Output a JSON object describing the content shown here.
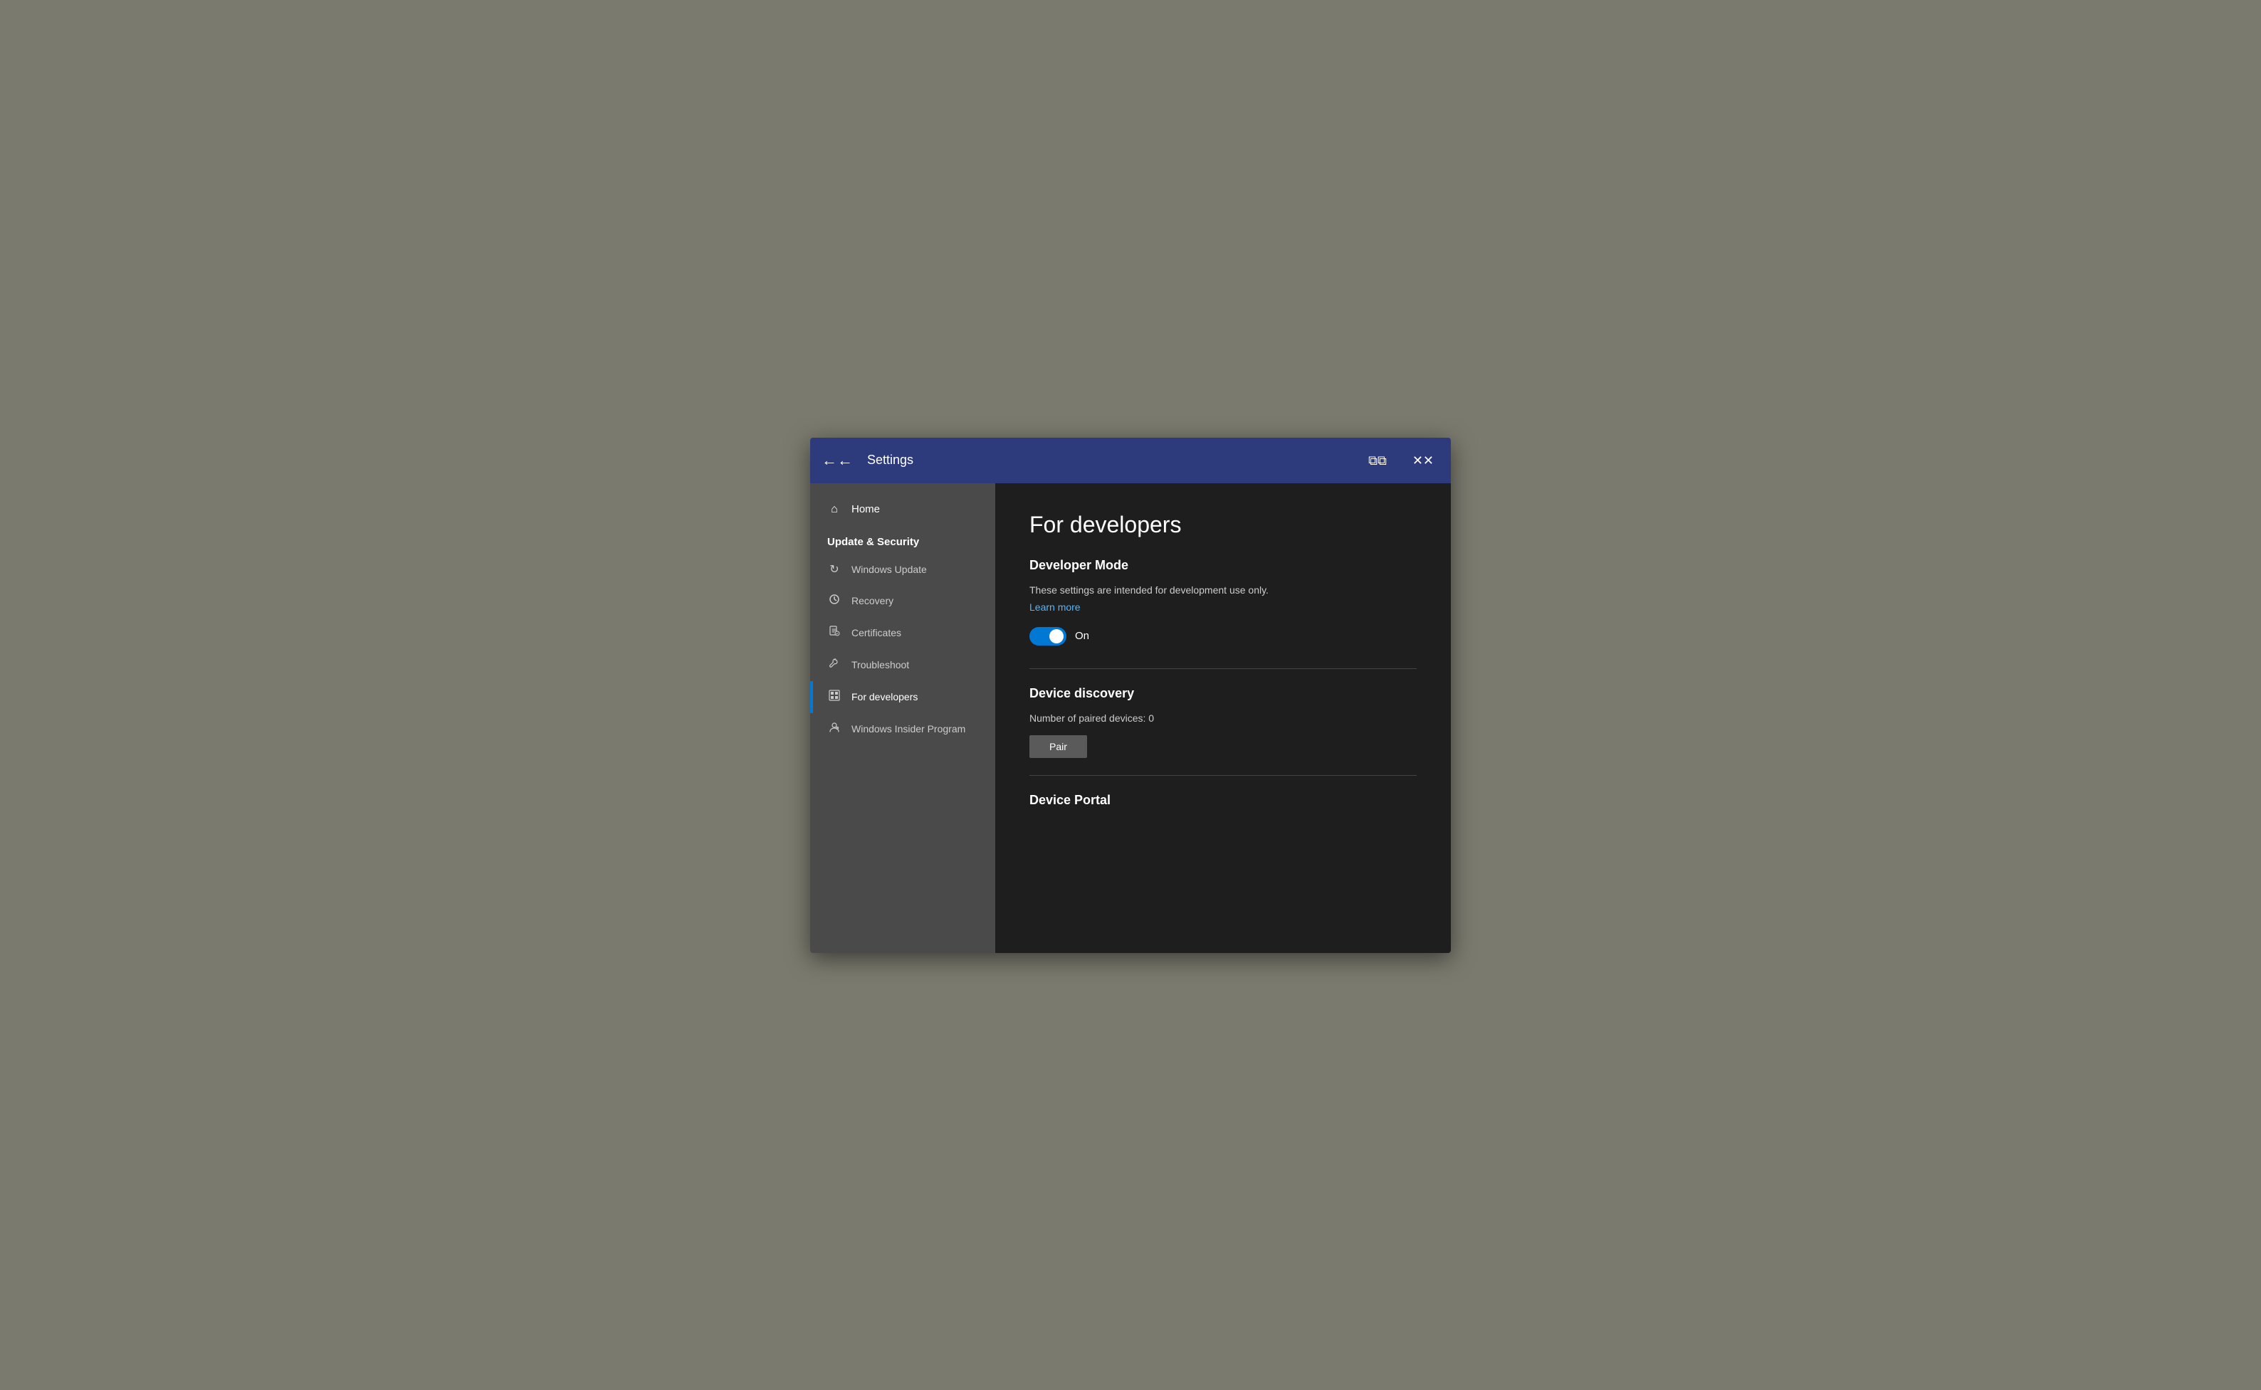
{
  "titlebar": {
    "back_label": "←",
    "title": "Settings",
    "restore_label": "⧉",
    "close_label": "✕"
  },
  "sidebar": {
    "home_label": "Home",
    "section_title": "Update & Security",
    "items": [
      {
        "id": "windows-update",
        "label": "Windows Update",
        "icon": "↻",
        "active": false
      },
      {
        "id": "recovery",
        "label": "Recovery",
        "icon": "⏰",
        "active": false
      },
      {
        "id": "certificates",
        "label": "Certificates",
        "icon": "📄",
        "active": false
      },
      {
        "id": "troubleshoot",
        "label": "Troubleshoot",
        "icon": "🔧",
        "active": false
      },
      {
        "id": "for-developers",
        "label": "For developers",
        "icon": "⊞",
        "active": true
      },
      {
        "id": "windows-insider",
        "label": "Windows Insider Program",
        "icon": "👤",
        "active": false
      }
    ]
  },
  "content": {
    "page_title": "For developers",
    "developer_mode": {
      "heading": "Developer Mode",
      "description": "These settings are intended for development use only.",
      "learn_more": "Learn more",
      "toggle_state": "On"
    },
    "device_discovery": {
      "heading": "Device discovery",
      "paired_devices_label": "Number of paired devices: 0",
      "pair_button_label": "Pair"
    },
    "device_portal": {
      "heading": "Device Portal"
    }
  },
  "colors": {
    "accent": "#0078d4",
    "toggle_on": "#0ea5e9",
    "sidebar_bg": "#4a4a4a",
    "content_bg": "#1e1e1e",
    "titlebar_bg": "#2d3a7c"
  }
}
